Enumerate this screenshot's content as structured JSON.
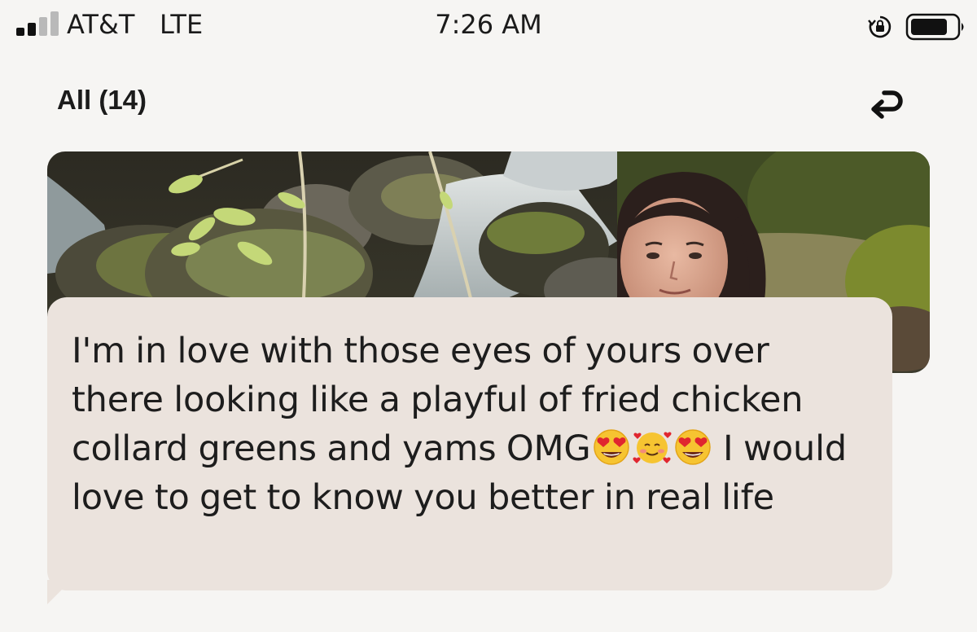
{
  "status_bar": {
    "carrier": "AT&T",
    "network": "LTE",
    "time": "7:26 AM"
  },
  "header": {
    "title": "All (14)",
    "reply_icon": "reply-arrow-icon"
  },
  "photo": {
    "icon": "profile-photo"
  },
  "message": {
    "part1": "I'm in love with those eyes of yours over there looking like a playful of fried chicken collard greens and yams OMG",
    "part2": " I would love to get to know you better in real life",
    "emojis": [
      "heart-eyes-emoji",
      "smiling-face-with-hearts-emoji",
      "heart-eyes-emoji"
    ]
  },
  "colors": {
    "bubble": "#ebe3dd",
    "background": "#f6f5f3",
    "text": "#1d1d1d"
  }
}
